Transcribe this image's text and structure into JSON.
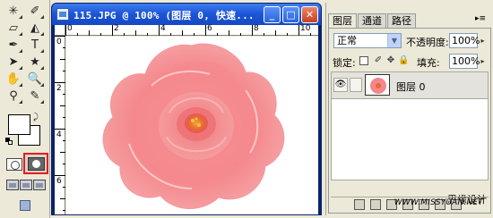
{
  "document": {
    "title": "115.JPG @ 100% (图层 0, 快速...",
    "ruler_h": [
      "0",
      "2",
      "4",
      "6",
      "8",
      "10"
    ],
    "ruler_v": [
      "0",
      "2",
      "4",
      "6"
    ],
    "minimize": "_",
    "maximize": "□",
    "close": "✕"
  },
  "toolbox": {
    "tools": [
      {
        "name": "magic-wand-icon",
        "glyph": "✳"
      },
      {
        "name": "healing-brush-icon",
        "glyph": "✐"
      },
      {
        "name": "eraser-icon",
        "glyph": "▱"
      },
      {
        "name": "sharpen-icon",
        "glyph": "◭"
      },
      {
        "name": "pen-icon",
        "glyph": "✒"
      },
      {
        "name": "type-icon",
        "glyph": "T"
      },
      {
        "name": "path-selection-icon",
        "glyph": "➤"
      },
      {
        "name": "custom-shape-icon",
        "glyph": "★"
      },
      {
        "name": "hand-icon",
        "glyph": "✋"
      },
      {
        "name": "zoom-icon",
        "glyph": "🔍"
      },
      {
        "name": "eyedropper-icon",
        "glyph": "⚲"
      },
      {
        "name": "notes-icon",
        "glyph": "✎"
      }
    ]
  },
  "layers": {
    "tabs": [
      "图层",
      "通道",
      "路径"
    ],
    "blend_mode": "正常",
    "opacity_label": "不透明度:",
    "opacity_value": "100%",
    "lock_label": "锁定:",
    "fill_label": "填充:",
    "fill_value": "100%",
    "layer_name": "图层 0",
    "visible_icon": "eye-icon"
  },
  "watermark": {
    "line1": "思缘设计",
    "line2": "WWW.MISSYUAN.NET"
  },
  "colors": {
    "titlebar": "#1b55d5",
    "quick_mask_highlight": "#e51c23",
    "rose_main": "#f4878c",
    "rose_center": "#e86a2e"
  }
}
